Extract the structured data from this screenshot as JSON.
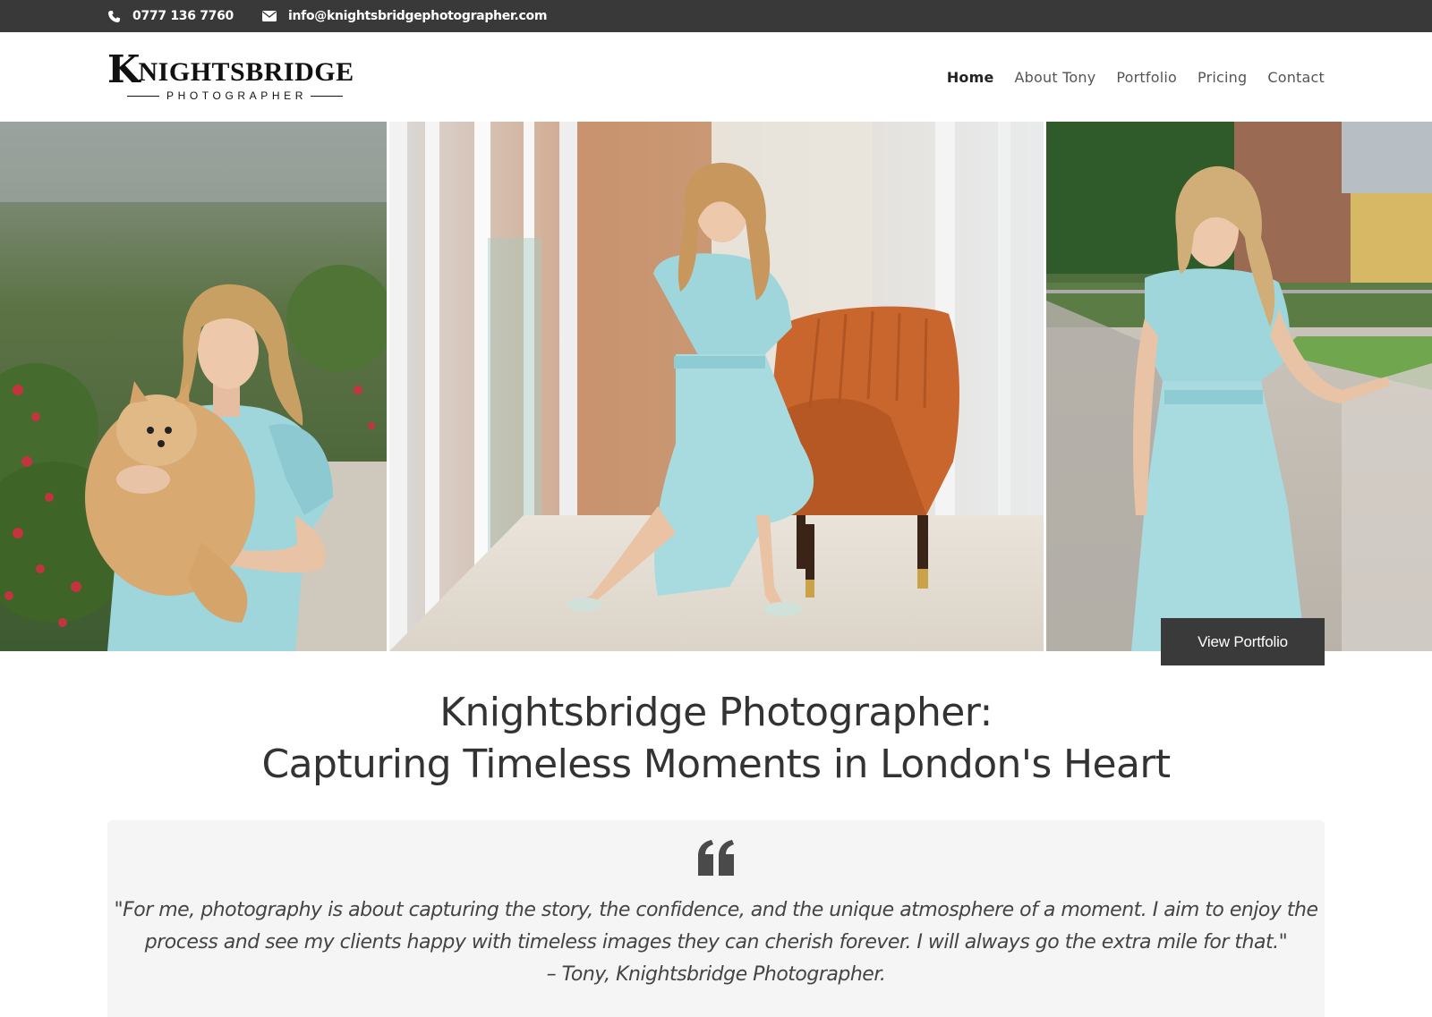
{
  "topbar": {
    "phone": "0777 136 7760",
    "email": "info@knightsbridgephotographer.com",
    "phone_icon": "phone-icon",
    "email_icon": "envelope-icon"
  },
  "logo": {
    "initial": "K",
    "main": "NIGHTSBRIDGE",
    "sub": "PHOTOGRAPHER"
  },
  "nav": {
    "items": [
      {
        "label": "Home",
        "active": true
      },
      {
        "label": "About Tony",
        "active": false
      },
      {
        "label": "Portfolio",
        "active": false
      },
      {
        "label": "Pricing",
        "active": false
      },
      {
        "label": "Contact",
        "active": false
      }
    ]
  },
  "hero": {
    "button_label": "View Portfolio"
  },
  "headline": {
    "line1": "Knightsbridge Photographer:",
    "line2": "Capturing Timeless Moments in London's Heart"
  },
  "quote": {
    "icon": "quote-icon",
    "line1": "\"For me, photography is about capturing the story, the confidence, and the unique atmosphere of a moment. I aim to enjoy the",
    "line2": "process and see my clients happy with timeless images they can cherish forever. I will always go the extra mile for that.\"",
    "line3": "– Tony, Knightsbridge Photographer."
  },
  "colors": {
    "topbar": "#393939",
    "button": "#3a3a3a",
    "quote_bg": "#f5f5f5",
    "dress": "#9fd6dc",
    "chair": "#c8662e"
  }
}
